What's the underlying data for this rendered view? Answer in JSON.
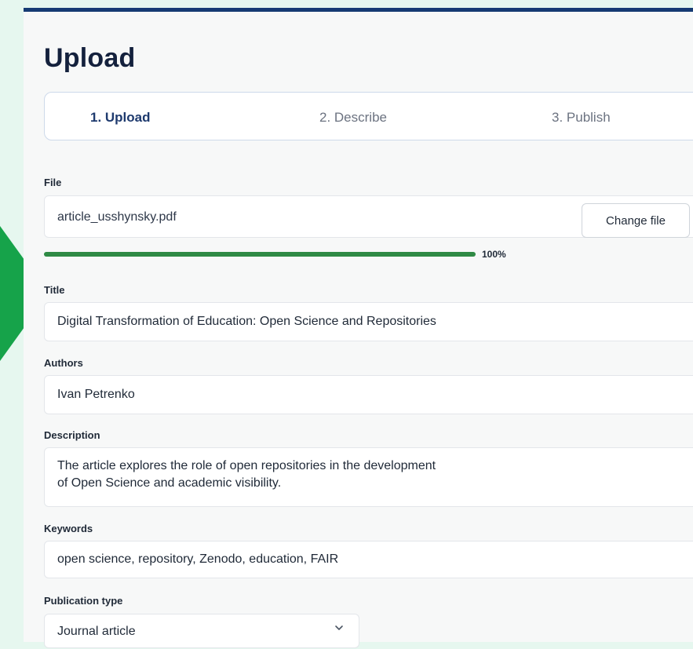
{
  "page": {
    "title": "Upload"
  },
  "steps": [
    {
      "label": "1. Upload",
      "active": true
    },
    {
      "label": "2. Describe",
      "active": false
    },
    {
      "label": "3. Publish",
      "active": false
    }
  ],
  "file": {
    "label": "File",
    "name": "article_usshynsky.pdf",
    "change_button": "Change file",
    "progress_percent": 100,
    "progress_label": "100%"
  },
  "title_field": {
    "label": "Title",
    "value": "Digital Transformation of Education: Open Science and Repositories"
  },
  "authors_field": {
    "label": "Authors",
    "value": "Ivan Petrenko"
  },
  "description_field": {
    "label": "Description",
    "value": "The article explores the role of open repositories in the development\nof Open Science and academic visibility."
  },
  "keywords_field": {
    "label": "Keywords",
    "value": "open science, repository, Zenodo, education, FAIR"
  },
  "publication_type": {
    "label": "Publication type",
    "selected": "Journal article"
  },
  "icons": {
    "arrow": "arrow-right-icon",
    "dropdown": "chevron-down-icon"
  },
  "colors": {
    "accent_green": "#16a34a",
    "progress_green": "#2f8a45",
    "header_navy": "#163b73",
    "background_mint": "#e6f7ef"
  }
}
